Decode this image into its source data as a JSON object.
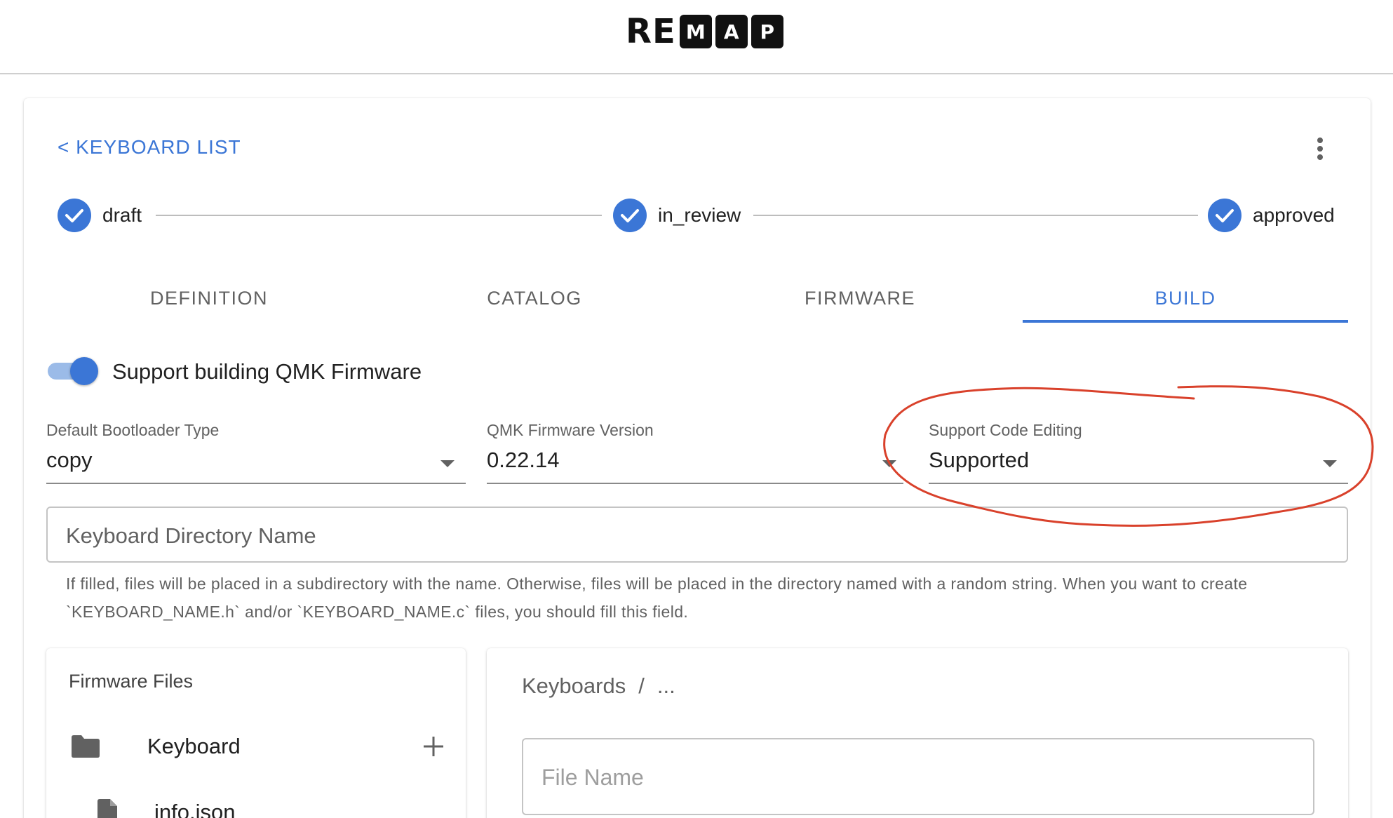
{
  "header": {
    "logo_letters_plain": "RE",
    "logo_letters_boxed": [
      "M",
      "A",
      "P"
    ]
  },
  "nav": {
    "back_label": "< KEYBOARD LIST",
    "more_icon": "more-vert-icon"
  },
  "stepper": {
    "steps": [
      {
        "label": "draft",
        "icon": "check-circle-icon"
      },
      {
        "label": "in_review",
        "icon": "check-circle-icon"
      },
      {
        "label": "approved",
        "icon": "check-circle-icon"
      }
    ]
  },
  "tabs": [
    {
      "label": "DEFINITION",
      "active": false
    },
    {
      "label": "CATALOG",
      "active": false
    },
    {
      "label": "FIRMWARE",
      "active": false
    },
    {
      "label": "BUILD",
      "active": true
    }
  ],
  "build": {
    "toggle_label": "Support building QMK Firmware",
    "toggle_on": true,
    "bootloader": {
      "label": "Default Bootloader Type",
      "value": "copy"
    },
    "qmk_version": {
      "label": "QMK Firmware Version",
      "value": "0.22.14"
    },
    "code_editing": {
      "label": "Support Code Editing",
      "value": "Supported"
    },
    "directory": {
      "placeholder": "Keyboard Directory Name",
      "helper": "If filled, files will be placed in a subdirectory with the name. Otherwise, files will be placed in the directory named with a random string. When you want to create `KEYBOARD_NAME.h` and/or `KEYBOARD_NAME.c` files, you should fill this field."
    }
  },
  "files_panel": {
    "title": "Firmware Files",
    "folder": {
      "label": "Keyboard",
      "icon": "folder-icon",
      "add_icon": "plus-icon"
    },
    "file": {
      "label": "info.json",
      "icon": "file-icon"
    }
  },
  "editor_panel": {
    "breadcrumb": [
      "Keyboards",
      "/",
      "..."
    ],
    "file_name_placeholder": "File Name"
  },
  "colors": {
    "accent": "#3b76d6",
    "annotation": "#d9412b"
  }
}
